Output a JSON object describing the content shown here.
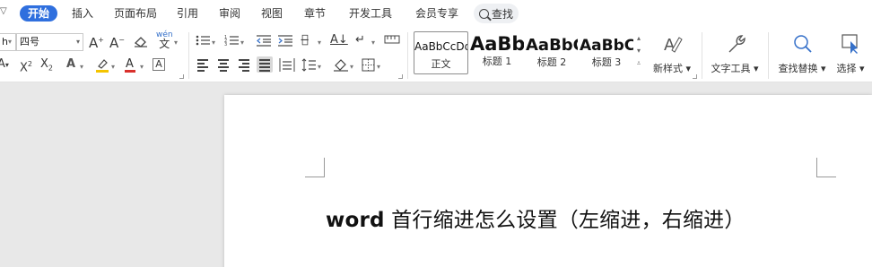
{
  "tabs": {
    "home": "开始",
    "insert": "插入",
    "layout": "页面布局",
    "references": "引用",
    "review": "审阅",
    "view": "视图",
    "section": "章节",
    "developer": "开发工具",
    "member": "会员专享",
    "search": "查找"
  },
  "font": {
    "name_partial": "h",
    "size": "四号"
  },
  "styles": [
    {
      "sample": "AaBbCcDd",
      "name": "正文",
      "selected": true
    },
    {
      "sample": "AaBb",
      "name": "标题 1"
    },
    {
      "sample": "AaBbC",
      "name": "标题 2"
    },
    {
      "sample": "AaBbC",
      "name": "标题 3"
    }
  ],
  "buttons": {
    "new_style": "新样式",
    "text_tools": "文字工具",
    "find_replace": "查找替换",
    "select": "选择"
  },
  "phonetic_glyph": "wén",
  "document": {
    "title_latin": "word",
    "title_cjk": " 首行缩进怎么设置（左缩进，右缩进）"
  },
  "colors": {
    "accent": "#2f6fde",
    "highlight": "#f4c400",
    "font_color": "#d9302c"
  }
}
